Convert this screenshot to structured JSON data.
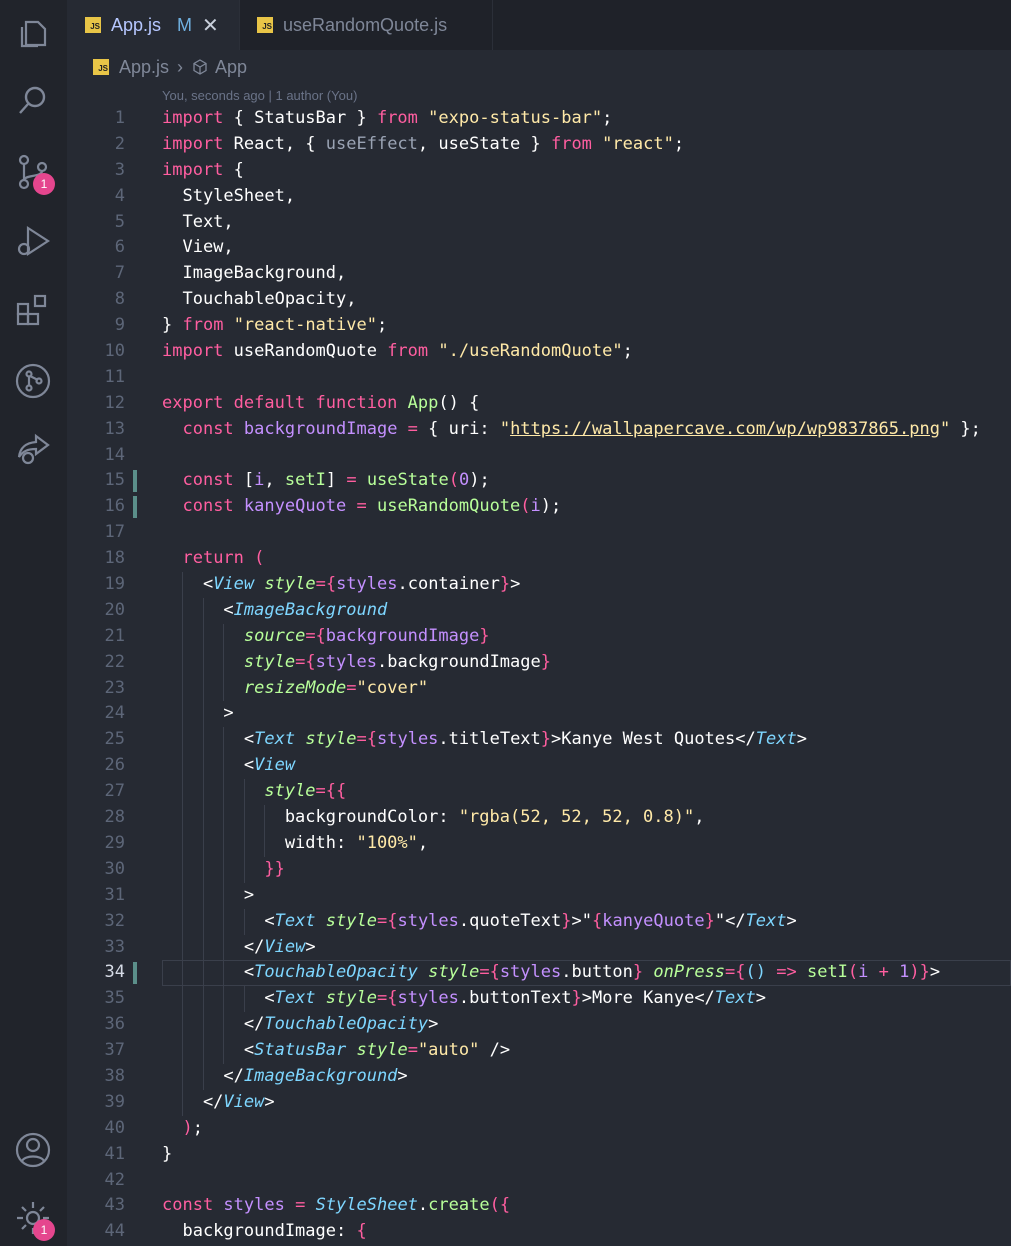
{
  "tabs": [
    {
      "label": "App.js",
      "modified": "M",
      "active": true
    },
    {
      "label": "useRandomQuote.js",
      "active": false
    }
  ],
  "breadcrumb": {
    "file": "App.js",
    "symbol": "App"
  },
  "blame": "You, seconds ago | 1 author (You)",
  "activity_badges": {
    "source_control": "1",
    "settings": "1"
  },
  "line_numbers": [
    "1",
    "2",
    "3",
    "4",
    "5",
    "6",
    "7",
    "8",
    "9",
    "10",
    "11",
    "12",
    "13",
    "14",
    "15",
    "16",
    "17",
    "18",
    "19",
    "20",
    "21",
    "22",
    "23",
    "24",
    "25",
    "26",
    "27",
    "28",
    "29",
    "30",
    "31",
    "32",
    "33",
    "34",
    "35",
    "36",
    "37",
    "38",
    "39",
    "40",
    "41",
    "42",
    "43",
    "44"
  ],
  "code": {
    "l1": [
      {
        "t": "import",
        "c": "k"
      },
      {
        "t": " { StatusBar } ",
        "c": "p"
      },
      {
        "t": "from",
        "c": "k"
      },
      {
        "t": " ",
        "c": "p"
      },
      {
        "t": "\"expo-status-bar\"",
        "c": "s"
      },
      {
        "t": ";",
        "c": "p"
      }
    ],
    "l2": [
      {
        "t": "import",
        "c": "k"
      },
      {
        "t": " React, { ",
        "c": "p"
      },
      {
        "t": "useEffect",
        "c": "dim"
      },
      {
        "t": ", useState } ",
        "c": "p"
      },
      {
        "t": "from",
        "c": "k"
      },
      {
        "t": " ",
        "c": "p"
      },
      {
        "t": "\"react\"",
        "c": "s"
      },
      {
        "t": ";",
        "c": "p"
      }
    ],
    "l3": [
      {
        "t": "import",
        "c": "k"
      },
      {
        "t": " {",
        "c": "p"
      }
    ],
    "l4": [
      {
        "t": "  StyleSheet,",
        "c": "p"
      }
    ],
    "l5": [
      {
        "t": "  Text,",
        "c": "p"
      }
    ],
    "l6": [
      {
        "t": "  View,",
        "c": "p"
      }
    ],
    "l7": [
      {
        "t": "  ImageBackground,",
        "c": "p"
      }
    ],
    "l8": [
      {
        "t": "  TouchableOpacity,",
        "c": "p"
      }
    ],
    "l9": [
      {
        "t": "} ",
        "c": "p"
      },
      {
        "t": "from",
        "c": "k"
      },
      {
        "t": " ",
        "c": "p"
      },
      {
        "t": "\"react-native\"",
        "c": "s"
      },
      {
        "t": ";",
        "c": "p"
      }
    ],
    "l10": [
      {
        "t": "import",
        "c": "k"
      },
      {
        "t": " useRandomQuote ",
        "c": "p"
      },
      {
        "t": "from",
        "c": "k"
      },
      {
        "t": " ",
        "c": "p"
      },
      {
        "t": "\"./useRandomQuote\"",
        "c": "s"
      },
      {
        "t": ";",
        "c": "p"
      }
    ],
    "l11": [],
    "l12": [
      {
        "t": "export default function ",
        "c": "k"
      },
      {
        "t": "App",
        "c": "f"
      },
      {
        "t": "() {",
        "c": "p"
      }
    ],
    "l13": [
      {
        "t": "  ",
        "c": "p"
      },
      {
        "t": "const",
        "c": "k"
      },
      {
        "t": " backgroundImage ",
        "c": "d"
      },
      {
        "t": "= ",
        "c": "k"
      },
      {
        "t": "{ uri: ",
        "c": "p"
      },
      {
        "t": "\"",
        "c": "s"
      },
      {
        "t": "https://wallpapercave.com/wp/wp9837865.png",
        "c": "s u"
      },
      {
        "t": "\"",
        "c": "s"
      },
      {
        "t": " };",
        "c": "p"
      }
    ],
    "l14": [],
    "l15": [
      {
        "t": "  ",
        "c": "p"
      },
      {
        "t": "const",
        "c": "k"
      },
      {
        "t": " [",
        "c": "p"
      },
      {
        "t": "i",
        "c": "d"
      },
      {
        "t": ", ",
        "c": "p"
      },
      {
        "t": "setI",
        "c": "f"
      },
      {
        "t": "] ",
        "c": "p"
      },
      {
        "t": "= ",
        "c": "k"
      },
      {
        "t": "useState",
        "c": "f"
      },
      {
        "t": "(",
        "c": "k"
      },
      {
        "t": "0",
        "c": "d"
      },
      {
        "t": ");",
        "c": "p"
      }
    ],
    "l16": [
      {
        "t": "  ",
        "c": "p"
      },
      {
        "t": "const",
        "c": "k"
      },
      {
        "t": " kanyeQuote ",
        "c": "d"
      },
      {
        "t": "= ",
        "c": "k"
      },
      {
        "t": "useRandomQuote",
        "c": "f"
      },
      {
        "t": "(",
        "c": "k"
      },
      {
        "t": "i",
        "c": "d"
      },
      {
        "t": ");",
        "c": "p"
      }
    ],
    "l17": [],
    "l18": [
      {
        "t": "  ",
        "c": "p"
      },
      {
        "t": "return (",
        "c": "k"
      }
    ],
    "l19": [
      {
        "t": "    <",
        "c": "p"
      },
      {
        "t": "View",
        "c": "tag"
      },
      {
        "t": " ",
        "c": "p"
      },
      {
        "t": "style",
        "c": "attr"
      },
      {
        "t": "={",
        "c": "k"
      },
      {
        "t": "styles",
        "c": "d"
      },
      {
        "t": ".container",
        "c": "p"
      },
      {
        "t": "}",
        "c": "k"
      },
      {
        "t": ">",
        "c": "p"
      }
    ],
    "l20": [
      {
        "t": "      <",
        "c": "p"
      },
      {
        "t": "ImageBackground",
        "c": "tag"
      }
    ],
    "l21": [
      {
        "t": "        ",
        "c": "p"
      },
      {
        "t": "source",
        "c": "attr"
      },
      {
        "t": "={",
        "c": "k"
      },
      {
        "t": "backgroundImage",
        "c": "d"
      },
      {
        "t": "}",
        "c": "k"
      }
    ],
    "l22": [
      {
        "t": "        ",
        "c": "p"
      },
      {
        "t": "style",
        "c": "attr"
      },
      {
        "t": "={",
        "c": "k"
      },
      {
        "t": "styles",
        "c": "d"
      },
      {
        "t": ".backgroundImage",
        "c": "p"
      },
      {
        "t": "}",
        "c": "k"
      }
    ],
    "l23": [
      {
        "t": "        ",
        "c": "p"
      },
      {
        "t": "resizeMode",
        "c": "attr"
      },
      {
        "t": "=",
        "c": "k"
      },
      {
        "t": "\"cover\"",
        "c": "s"
      }
    ],
    "l24": [
      {
        "t": "      >",
        "c": "p"
      }
    ],
    "l25": [
      {
        "t": "        <",
        "c": "p"
      },
      {
        "t": "Text",
        "c": "tag"
      },
      {
        "t": " ",
        "c": "p"
      },
      {
        "t": "style",
        "c": "attr"
      },
      {
        "t": "={",
        "c": "k"
      },
      {
        "t": "styles",
        "c": "d"
      },
      {
        "t": ".titleText",
        "c": "p"
      },
      {
        "t": "}",
        "c": "k"
      },
      {
        "t": ">Kanye West Quotes</",
        "c": "p"
      },
      {
        "t": "Text",
        "c": "tag"
      },
      {
        "t": ">",
        "c": "p"
      }
    ],
    "l26": [
      {
        "t": "        <",
        "c": "p"
      },
      {
        "t": "View",
        "c": "tag"
      }
    ],
    "l27": [
      {
        "t": "          ",
        "c": "p"
      },
      {
        "t": "style",
        "c": "attr"
      },
      {
        "t": "={{",
        "c": "k"
      }
    ],
    "l28": [
      {
        "t": "            backgroundColor: ",
        "c": "p"
      },
      {
        "t": "\"rgba(52, 52, 52, 0.8)\"",
        "c": "s"
      },
      {
        "t": ",",
        "c": "p"
      }
    ],
    "l29": [
      {
        "t": "            width: ",
        "c": "p"
      },
      {
        "t": "\"100%\"",
        "c": "s"
      },
      {
        "t": ",",
        "c": "p"
      }
    ],
    "l30": [
      {
        "t": "          ",
        "c": "p"
      },
      {
        "t": "}}",
        "c": "k"
      }
    ],
    "l31": [
      {
        "t": "        >",
        "c": "p"
      }
    ],
    "l32": [
      {
        "t": "          <",
        "c": "p"
      },
      {
        "t": "Text",
        "c": "tag"
      },
      {
        "t": " ",
        "c": "p"
      },
      {
        "t": "style",
        "c": "attr"
      },
      {
        "t": "={",
        "c": "k"
      },
      {
        "t": "styles",
        "c": "d"
      },
      {
        "t": ".quoteText",
        "c": "p"
      },
      {
        "t": "}",
        "c": "k"
      },
      {
        "t": ">\"",
        "c": "p"
      },
      {
        "t": "{",
        "c": "k"
      },
      {
        "t": "kanyeQuote",
        "c": "d"
      },
      {
        "t": "}",
        "c": "k"
      },
      {
        "t": "\"</",
        "c": "p"
      },
      {
        "t": "Text",
        "c": "tag"
      },
      {
        "t": ">",
        "c": "p"
      }
    ],
    "l33": [
      {
        "t": "        </",
        "c": "p"
      },
      {
        "t": "View",
        "c": "tag"
      },
      {
        "t": ">",
        "c": "p"
      }
    ],
    "l34": [
      {
        "t": "        <",
        "c": "p"
      },
      {
        "t": "TouchableOpacity",
        "c": "tag"
      },
      {
        "t": " ",
        "c": "p"
      },
      {
        "t": "style",
        "c": "attr"
      },
      {
        "t": "={",
        "c": "k"
      },
      {
        "t": "styles",
        "c": "d"
      },
      {
        "t": ".button",
        "c": "p"
      },
      {
        "t": "}",
        "c": "k"
      },
      {
        "t": " ",
        "c": "p"
      },
      {
        "t": "onPress",
        "c": "attr"
      },
      {
        "t": "={",
        "c": "k"
      },
      {
        "t": "() ",
        "c": "c"
      },
      {
        "t": "=> ",
        "c": "k"
      },
      {
        "t": "setI",
        "c": "f"
      },
      {
        "t": "(",
        "c": "k"
      },
      {
        "t": "i ",
        "c": "d"
      },
      {
        "t": "+ ",
        "c": "k"
      },
      {
        "t": "1",
        "c": "d"
      },
      {
        "t": ")}",
        "c": "k"
      },
      {
        "t": ">",
        "c": "p"
      }
    ],
    "l35": [
      {
        "t": "          <",
        "c": "p"
      },
      {
        "t": "Text",
        "c": "tag"
      },
      {
        "t": " ",
        "c": "p"
      },
      {
        "t": "style",
        "c": "attr"
      },
      {
        "t": "={",
        "c": "k"
      },
      {
        "t": "styles",
        "c": "d"
      },
      {
        "t": ".buttonText",
        "c": "p"
      },
      {
        "t": "}",
        "c": "k"
      },
      {
        "t": ">More Kanye</",
        "c": "p"
      },
      {
        "t": "Text",
        "c": "tag"
      },
      {
        "t": ">",
        "c": "p"
      }
    ],
    "l36": [
      {
        "t": "        </",
        "c": "p"
      },
      {
        "t": "TouchableOpacity",
        "c": "tag"
      },
      {
        "t": ">",
        "c": "p"
      }
    ],
    "l37": [
      {
        "t": "        <",
        "c": "p"
      },
      {
        "t": "StatusBar",
        "c": "tag"
      },
      {
        "t": " ",
        "c": "p"
      },
      {
        "t": "style",
        "c": "attr"
      },
      {
        "t": "=",
        "c": "k"
      },
      {
        "t": "\"auto\"",
        "c": "s"
      },
      {
        "t": " />",
        "c": "p"
      }
    ],
    "l38": [
      {
        "t": "      </",
        "c": "p"
      },
      {
        "t": "ImageBackground",
        "c": "tag"
      },
      {
        "t": ">",
        "c": "p"
      }
    ],
    "l39": [
      {
        "t": "    </",
        "c": "p"
      },
      {
        "t": "View",
        "c": "tag"
      },
      {
        "t": ">",
        "c": "p"
      }
    ],
    "l40": [
      {
        "t": "  ",
        "c": "p"
      },
      {
        "t": ")",
        "c": "k"
      },
      {
        "t": ";",
        "c": "p"
      }
    ],
    "l41": [
      {
        "t": "}",
        "c": "p"
      }
    ],
    "l42": [],
    "l43": [
      {
        "t": "const",
        "c": "k"
      },
      {
        "t": " styles ",
        "c": "d"
      },
      {
        "t": "= ",
        "c": "k"
      },
      {
        "t": "StyleSheet",
        "c": "tag"
      },
      {
        "t": ".",
        "c": "p"
      },
      {
        "t": "create",
        "c": "f"
      },
      {
        "t": "({",
        "c": "k"
      }
    ],
    "l44": [
      {
        "t": "  backgroundImage: ",
        "c": "p"
      },
      {
        "t": "{",
        "c": "k"
      }
    ]
  },
  "colors": {
    "background": "#262a33",
    "activity_bar": "#21242b",
    "keyword": "#ff5ea0",
    "string": "#ffe9a8",
    "variable": "#c490ff",
    "function": "#b8ff9a",
    "tag": "#7ed6ff",
    "badge": "#e5468e"
  },
  "activity_icons": [
    "files-icon",
    "search-icon",
    "source-control-icon",
    "run-debug-icon",
    "extensions-icon",
    "git-graph-icon",
    "live-share-icon",
    "account-icon",
    "settings-gear-icon"
  ]
}
